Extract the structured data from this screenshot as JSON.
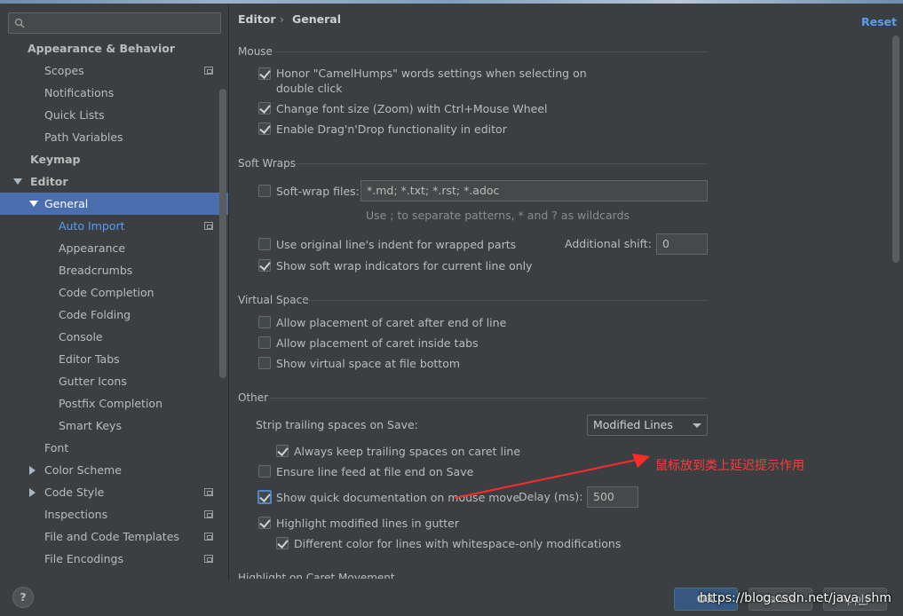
{
  "search": {
    "placeholder": ""
  },
  "sidebar": {
    "items": [
      {
        "label": "Appearance & Behavior"
      },
      {
        "label": "Scopes"
      },
      {
        "label": "Notifications"
      },
      {
        "label": "Quick Lists"
      },
      {
        "label": "Path Variables"
      },
      {
        "label": "Keymap"
      },
      {
        "label": "Editor"
      },
      {
        "label": "General"
      },
      {
        "label": "Auto Import"
      },
      {
        "label": "Appearance"
      },
      {
        "label": "Breadcrumbs"
      },
      {
        "label": "Code Completion"
      },
      {
        "label": "Code Folding"
      },
      {
        "label": "Console"
      },
      {
        "label": "Editor Tabs"
      },
      {
        "label": "Gutter Icons"
      },
      {
        "label": "Postfix Completion"
      },
      {
        "label": "Smart Keys"
      },
      {
        "label": "Font"
      },
      {
        "label": "Color Scheme"
      },
      {
        "label": "Code Style"
      },
      {
        "label": "Inspections"
      },
      {
        "label": "File and Code Templates"
      },
      {
        "label": "File Encodings"
      }
    ]
  },
  "header": {
    "title": "Editor",
    "separator": "›",
    "subtitle": "General",
    "reset": "Reset"
  },
  "mouse": {
    "title": "Mouse",
    "camelhumps_line1": "Honor \"CamelHumps\" words settings when selecting on",
    "camelhumps_line2": "double click",
    "zoom": "Change font size (Zoom) with Ctrl+Mouse Wheel",
    "dragdrop": "Enable Drag'n'Drop functionality in editor"
  },
  "softwraps": {
    "title": "Soft Wraps",
    "files_label": "Soft-wrap files:",
    "files_value": "*.md; *.txt; *.rst; *.adoc",
    "hint": "Use ; to separate patterns, * and ? as wildcards",
    "indent": "Use original line's indent for wrapped parts",
    "additional_shift_label": "Additional shift:",
    "additional_shift_value": "0",
    "indicators": "Show soft wrap indicators for current line only"
  },
  "virtual": {
    "title": "Virtual Space",
    "after_end": "Allow placement of caret after end of line",
    "inside_tabs": "Allow placement of caret inside tabs",
    "file_bottom": "Show virtual space at file bottom"
  },
  "other": {
    "title": "Other",
    "strip_label": "Strip trailing spaces on Save:",
    "strip_value": "Modified Lines",
    "keep_trailing": "Always keep trailing spaces on caret line",
    "line_feed": "Ensure line feed at file end on Save",
    "quick_doc": "Show quick documentation on mouse move",
    "delay_label": "Delay (ms):",
    "delay_value": "500",
    "highlight_modified": "Highlight modified lines in gutter",
    "different_color": "Different color for lines with whitespace-only modifications"
  },
  "annotation": {
    "text": "鼠标放到类上延迟提示作用",
    "color": "#ff3a3a"
  },
  "cut_section": "Highlight on Caret Movement",
  "footer": {
    "help": "?",
    "ok": "OK",
    "cancel": "Cancel",
    "apply": "Apply"
  },
  "watermark": "https://blog.csdn.net/java_shm",
  "colors": {
    "background": "#3c3f41",
    "selection": "#4b6eaf",
    "link": "#589df6"
  }
}
